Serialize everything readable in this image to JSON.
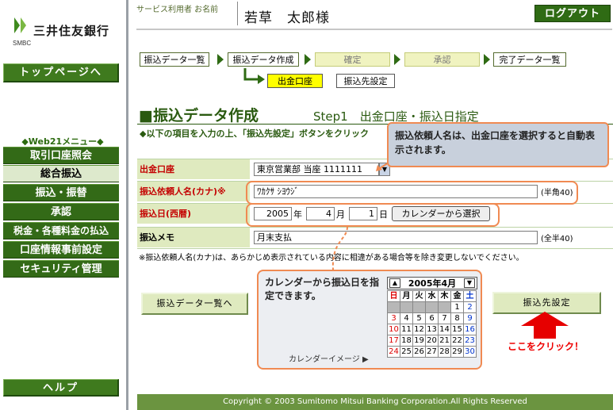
{
  "brand": {
    "name": "三井住友銀行",
    "abbr": "SMBC",
    "color": "#3f7a1e"
  },
  "sidebar": {
    "top_button": "トップページへ",
    "section_label": "◆Web21メニュー◆",
    "items": [
      {
        "label": "取引口座照会",
        "active": false
      },
      {
        "label": "総合振込",
        "active": true
      },
      {
        "label": "振込・振替",
        "active": false
      },
      {
        "label": "承認",
        "active": false
      },
      {
        "label": "税金・各種料金の払込",
        "active": false
      },
      {
        "label": "口座情報事前設定",
        "active": false
      },
      {
        "label": "セキュリティ管理",
        "active": false
      }
    ],
    "help_button": "ヘルプ"
  },
  "header": {
    "user_label": "サービス利用者 お名前",
    "user_name": "若草　太郎様",
    "logout": "ログアウト"
  },
  "steps": [
    "振込データ一覧",
    "振込データ作成",
    "確定",
    "承認",
    "完了データ一覧"
  ],
  "subtabs": {
    "source": "出金口座",
    "destination": "振込先設定"
  },
  "title": {
    "main": "■振込データ作成",
    "step": "Step1　出金口座・振込日指定",
    "instruction": "◆以下の項目を入力の上、「振込先設定」ボタンをクリック"
  },
  "form": {
    "account": {
      "label": "出金口座",
      "value": "東京営業部 当座 1111111"
    },
    "requester": {
      "label": "振込依頼人名(カナ)※",
      "value": "ﾜｶｸｻ ｼﾖｳｼﾞ",
      "hint": "(半角40)"
    },
    "date": {
      "label": "振込日(西暦)",
      "year": "2005",
      "year_unit": "年",
      "month": "4",
      "month_unit": "月",
      "day": "1",
      "day_unit": "日",
      "calendar_button": "カレンダーから選択"
    },
    "memo": {
      "label": "振込メモ",
      "value": "月末支払",
      "hint": "(全半40)"
    }
  },
  "note": "※振込依頼人名(カナ)は、あらかじめ表示されている内容に相違がある場合等を除き変更しないでください。",
  "callouts": {
    "requester": "振込依頼人名は、出金口座を選択すると自動表示されます。",
    "calendar": "カレンダーから振込日を指定できます。",
    "calendar_image_label": "カレンダーイメージ ▶",
    "click_here": "ここをクリック！"
  },
  "calendar": {
    "title": "2005年4月",
    "weekdays": [
      "日",
      "月",
      "火",
      "水",
      "木",
      "金",
      "土"
    ],
    "weeks": [
      [
        "",
        "",
        "",
        "",
        "",
        "1",
        "2"
      ],
      [
        "3",
        "4",
        "5",
        "6",
        "7",
        "8",
        "9"
      ],
      [
        "10",
        "11",
        "12",
        "13",
        "14",
        "15",
        "16"
      ],
      [
        "17",
        "18",
        "19",
        "20",
        "21",
        "22",
        "23"
      ],
      [
        "24",
        "25",
        "26",
        "27",
        "28",
        "29",
        "30"
      ]
    ]
  },
  "buttons": {
    "back": "振込データ一覧へ",
    "next": "振込先設定"
  },
  "footer": "Copyright © 2003 Sumitomo Mitsui Banking Corporation.All Rights Reserved"
}
